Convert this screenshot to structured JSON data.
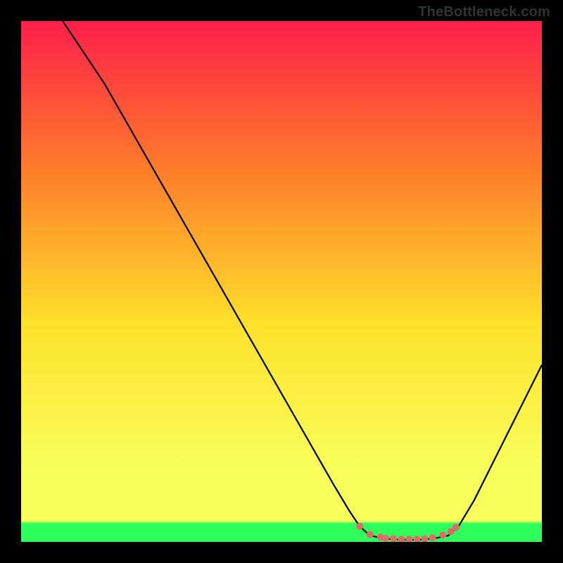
{
  "watermark": "TheBottleneck.com",
  "chart_data": {
    "type": "line",
    "title": "",
    "xlabel": "",
    "ylabel": "",
    "xlim": [
      0,
      100
    ],
    "ylim": [
      0,
      100
    ],
    "grid": false,
    "gradient": {
      "top": "#ff1f4b",
      "upper_mid": "#ff7a2a",
      "mid": "#ffe02a",
      "lower_mid": "#f7ff5a",
      "bottom_band": "#2eff5a"
    },
    "curve": {
      "color": "#000000",
      "points_xy": [
        [
          8,
          100
        ],
        [
          12,
          94
        ],
        [
          16,
          88
        ],
        [
          20,
          81
        ],
        [
          24,
          74
        ],
        [
          28,
          67
        ],
        [
          32,
          60
        ],
        [
          36,
          53
        ],
        [
          40,
          46
        ],
        [
          44,
          39
        ],
        [
          48,
          32
        ],
        [
          52,
          25
        ],
        [
          56,
          18
        ],
        [
          60,
          11
        ],
        [
          63,
          6
        ],
        [
          65,
          3
        ],
        [
          67,
          1.2
        ],
        [
          70,
          0.6
        ],
        [
          73,
          0.4
        ],
        [
          76,
          0.4
        ],
        [
          79,
          0.6
        ],
        [
          82,
          1.2
        ],
        [
          84,
          3
        ],
        [
          87,
          8
        ],
        [
          90,
          14
        ],
        [
          94,
          22
        ],
        [
          100,
          34
        ]
      ]
    },
    "markers": {
      "color": "#e06a6a",
      "points_xy": [
        [
          65,
          3.0
        ],
        [
          67,
          1.4
        ],
        [
          69,
          0.9
        ],
        [
          70,
          0.7
        ],
        [
          71.5,
          0.6
        ],
        [
          73,
          0.5
        ],
        [
          74.5,
          0.5
        ],
        [
          76,
          0.5
        ],
        [
          77.5,
          0.6
        ],
        [
          79,
          0.8
        ],
        [
          81,
          1.3
        ],
        [
          82.5,
          2.0
        ],
        [
          83.5,
          2.8
        ]
      ]
    }
  }
}
